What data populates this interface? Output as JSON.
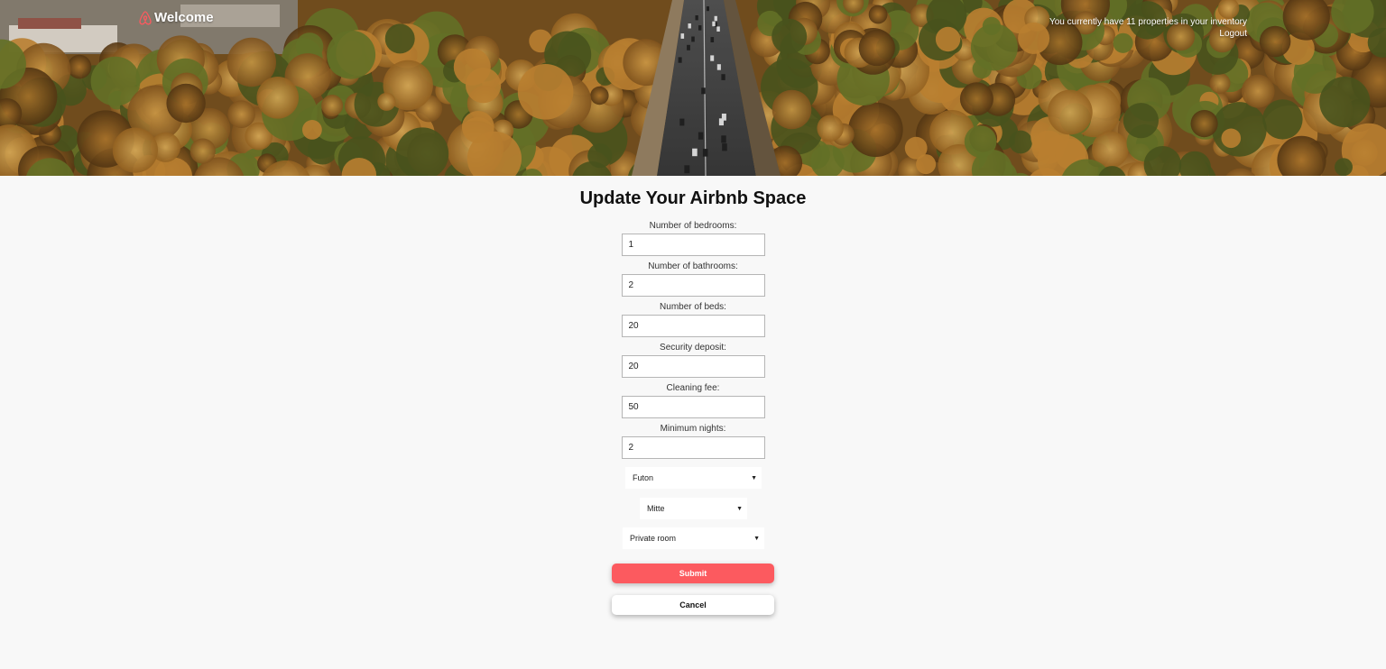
{
  "header": {
    "brand_title": "Welcome",
    "inventory_text": "You currently have 11 properties in your inventory",
    "logout_label": "Logout",
    "logo_icon": "airbnb-logo-icon"
  },
  "main": {
    "title": "Update Your Airbnb Space",
    "fields": [
      {
        "label": "Number of bedrooms:",
        "value": "1"
      },
      {
        "label": "Number of bathrooms:",
        "value": "2"
      },
      {
        "label": "Number of beds:",
        "value": "20"
      },
      {
        "label": "Security deposit:",
        "value": "20"
      },
      {
        "label": "Cleaning fee:",
        "value": "50"
      },
      {
        "label": "Minimum nights:",
        "value": "2"
      }
    ],
    "selects": {
      "bed_type": "Futon",
      "neighbourhood": "Mitte",
      "room_type": "Private room"
    },
    "submit_label": "Submit",
    "cancel_label": "Cancel"
  },
  "colors": {
    "accent": "#fc5a5f",
    "page_background": "#f8f8f8"
  }
}
